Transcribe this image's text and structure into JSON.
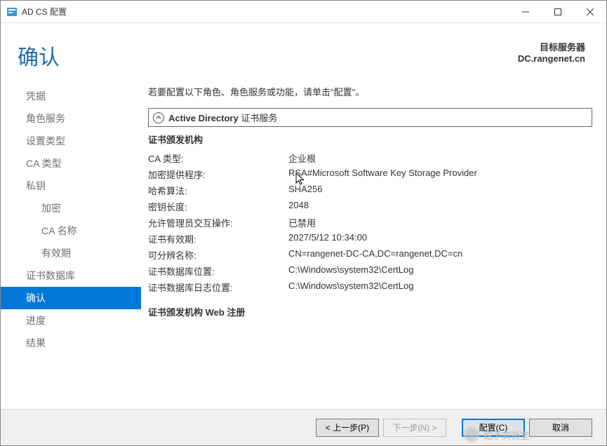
{
  "window": {
    "title": "AD CS 配置"
  },
  "header": {
    "title": "确认",
    "target_label": "目标服务器",
    "target_server": "DC.rangenet.cn"
  },
  "sidebar": {
    "items": [
      {
        "label": "凭据",
        "indent": false,
        "active": false
      },
      {
        "label": "角色服务",
        "indent": false,
        "active": false
      },
      {
        "label": "设置类型",
        "indent": false,
        "active": false
      },
      {
        "label": "CA 类型",
        "indent": false,
        "active": false
      },
      {
        "label": "私钥",
        "indent": false,
        "active": false
      },
      {
        "label": "加密",
        "indent": true,
        "active": false
      },
      {
        "label": "CA 名称",
        "indent": true,
        "active": false
      },
      {
        "label": "有效期",
        "indent": true,
        "active": false
      },
      {
        "label": "证书数据库",
        "indent": false,
        "active": false
      },
      {
        "label": "确认",
        "indent": false,
        "active": true
      },
      {
        "label": "进度",
        "indent": false,
        "active": false
      },
      {
        "label": "结果",
        "indent": false,
        "active": false
      }
    ]
  },
  "content": {
    "instruction": "若要配置以下角色、角色服务或功能，请单击\"配置\"。",
    "section_title_bold": "Active Directory",
    "section_title_rest": " 证书服务",
    "group_heading": "证书颁发机构",
    "group_heading2": "证书颁发机构 Web 注册",
    "properties": [
      {
        "label": "CA 类型:",
        "value": "企业根"
      },
      {
        "label": "加密提供程序:",
        "value": "RSA#Microsoft Software Key Storage Provider"
      },
      {
        "label": "哈希算法:",
        "value": "SHA256"
      },
      {
        "label": "密钥长度:",
        "value": "2048"
      },
      {
        "label": "允许管理员交互操作:",
        "value": "已禁用"
      },
      {
        "label": "证书有效期:",
        "value": "2027/5/12 10:34:00"
      },
      {
        "label": "可分辨名称:",
        "value": "CN=rangenet-DC-CA,DC=rangenet,DC=cn"
      },
      {
        "label": "证书数据库位置:",
        "value": "C:\\Windows\\system32\\CertLog"
      },
      {
        "label": "证书数据库日志位置:",
        "value": "C:\\Windows\\system32\\CertLog"
      }
    ]
  },
  "footer": {
    "previous": "< 上一步(P)",
    "next": "下一步(N) >",
    "configure": "配置(C)",
    "cancel": "取消"
  },
  "watermark": {
    "text": "蛇矛实验室"
  }
}
